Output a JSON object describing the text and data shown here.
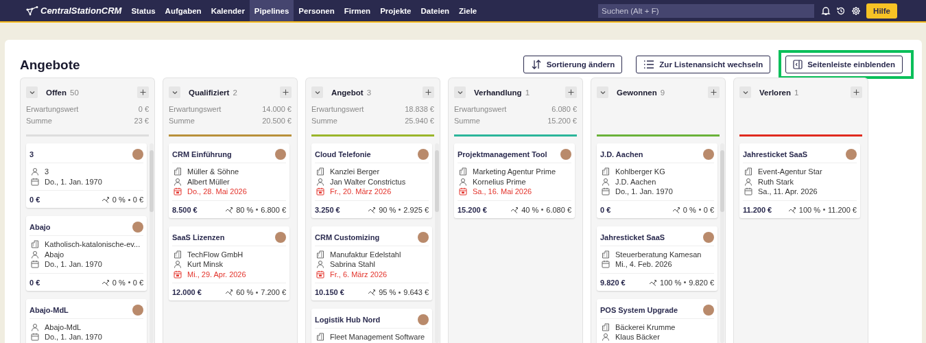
{
  "app": {
    "logo": "CentralStationCRM",
    "nav": [
      {
        "label": "Status",
        "selected": false
      },
      {
        "label": "Aufgaben",
        "selected": false
      },
      {
        "label": "Kalender",
        "selected": false
      },
      {
        "label": "Pipelines",
        "selected": true
      },
      {
        "label": "Personen",
        "selected": false
      },
      {
        "label": "Firmen",
        "selected": false
      },
      {
        "label": "Projekte",
        "selected": false
      },
      {
        "label": "Dateien",
        "selected": false
      },
      {
        "label": "Ziele",
        "selected": false
      }
    ],
    "search": {
      "placeholder": "Suchen (Alt + F)"
    },
    "help_button": "Hilfe"
  },
  "page": {
    "title": "Angebote",
    "actions": [
      {
        "kind": "sort",
        "label": "Sortierung ändern",
        "highlighted": false
      },
      {
        "kind": "list",
        "label": "Zur Listenansicht wechseln",
        "highlighted": false
      },
      {
        "kind": "sidebar",
        "label": "Seitenleiste einblenden",
        "highlighted": true
      }
    ]
  },
  "columns": [
    {
      "name": "Offen",
      "count": "50",
      "stats": [
        {
          "label": "Erwartungswert",
          "value": "0 €"
        },
        {
          "label": "Summe",
          "value": "23 €"
        }
      ],
      "color": "#dddddd",
      "cards": [
        {
          "title": "3",
          "lines": [
            {
              "kind": "person",
              "text": "3"
            },
            {
              "kind": "date",
              "text": "Do., 1. Jan. 1970",
              "overdue": false
            }
          ],
          "amount": "0 €",
          "probability": "0 %",
          "weighted": "0 €"
        },
        {
          "title": "Abajo",
          "lines": [
            {
              "kind": "company",
              "text": "Katholisch-katalonische-ev..."
            },
            {
              "kind": "person",
              "text": "Abajo"
            },
            {
              "kind": "date",
              "text": "Do., 1. Jan. 1970",
              "overdue": false
            }
          ],
          "amount": "0 €",
          "probability": "0 %",
          "weighted": "0 €"
        },
        {
          "title": "Abajo-MdL",
          "lines": [
            {
              "kind": "person",
              "text": "Abajo-MdL"
            },
            {
              "kind": "date",
              "text": "Do., 1. Jan. 1970",
              "overdue": false
            }
          ]
        }
      ]
    },
    {
      "name": "Qualifiziert",
      "count": "2",
      "stats": [
        {
          "label": "Erwartungswert",
          "value": "14.000 €"
        },
        {
          "label": "Summe",
          "value": "20.500 €"
        }
      ],
      "color": "#b8903a",
      "cards": [
        {
          "title": "CRM Einführung",
          "lines": [
            {
              "kind": "company",
              "text": "Müller & Söhne"
            },
            {
              "kind": "person",
              "text": "Albert Müller"
            },
            {
              "kind": "date",
              "text": "Do., 28. Mai 2026",
              "overdue": true
            }
          ],
          "amount": "8.500 €",
          "probability": "80 %",
          "weighted": "6.800 €"
        },
        {
          "title": "SaaS Lizenzen",
          "lines": [
            {
              "kind": "company",
              "text": "TechFlow GmbH"
            },
            {
              "kind": "person",
              "text": "Kurt Minsk"
            },
            {
              "kind": "date",
              "text": "Mi., 29. Apr. 2026",
              "overdue": true
            }
          ],
          "amount": "12.000 €",
          "probability": "60 %",
          "weighted": "7.200 €"
        }
      ]
    },
    {
      "name": "Angebot",
      "count": "3",
      "stats": [
        {
          "label": "Erwartungswert",
          "value": "18.838 €"
        },
        {
          "label": "Summe",
          "value": "25.940 €"
        }
      ],
      "color": "#9ab52a",
      "cards": [
        {
          "title": "Cloud Telefonie",
          "lines": [
            {
              "kind": "company",
              "text": "Kanzlei Berger"
            },
            {
              "kind": "person",
              "text": "Jan Walter Constrictus"
            },
            {
              "kind": "date",
              "text": "Fr., 20. März 2026",
              "overdue": true
            }
          ],
          "amount": "3.250 €",
          "probability": "90 %",
          "weighted": "2.925 €"
        },
        {
          "title": "CRM Customizing",
          "lines": [
            {
              "kind": "company",
              "text": "Manufaktur Edelstahl"
            },
            {
              "kind": "person",
              "text": "Sabrina Stahl"
            },
            {
              "kind": "date",
              "text": "Fr., 6. März 2026",
              "overdue": true
            }
          ],
          "amount": "10.150 €",
          "probability": "95 %",
          "weighted": "9.643 €"
        },
        {
          "title": "Logistik Hub Nord",
          "lines": [
            {
              "kind": "company",
              "text": "Fleet Management Software"
            }
          ]
        }
      ]
    },
    {
      "name": "Verhandlung",
      "count": "1",
      "stats": [
        {
          "label": "Erwartungswert",
          "value": "6.080 €"
        },
        {
          "label": "Summe",
          "value": "15.200 €"
        }
      ],
      "color": "#2bb59a",
      "cards": [
        {
          "title": "Projektmanagement Tool",
          "lines": [
            {
              "kind": "company",
              "text": "Marketing Agentur Prime"
            },
            {
              "kind": "person",
              "text": "Kornelius Prime"
            },
            {
              "kind": "date",
              "text": "Sa., 16. Mai 2026",
              "overdue": true
            }
          ],
          "amount": "15.200 €",
          "probability": "40 %",
          "weighted": "6.080 €"
        }
      ]
    },
    {
      "name": "Gewonnen",
      "count": "9",
      "color": "#6ab23a",
      "cards": [
        {
          "title": "J.D. Aachen",
          "lines": [
            {
              "kind": "company",
              "text": "Kohlberger KG"
            },
            {
              "kind": "person",
              "text": "J.D. Aachen"
            },
            {
              "kind": "date",
              "text": "Do., 1. Jan. 1970",
              "overdue": false
            }
          ],
          "amount": "0 €",
          "probability": "0 %",
          "weighted": "0 €"
        },
        {
          "title": "Jahresticket SaaS",
          "lines": [
            {
              "kind": "company",
              "text": "Steuerberatung Kamesan"
            },
            {
              "kind": "date",
              "text": "Mi., 4. Feb. 2026",
              "overdue": false
            }
          ],
          "amount": "9.820 €",
          "probability": "100 %",
          "weighted": "9.820 €"
        },
        {
          "title": "POS System Upgrade",
          "lines": [
            {
              "kind": "company",
              "text": "Bäckerei Krumme"
            },
            {
              "kind": "person",
              "text": "Klaus Bäcker"
            }
          ]
        }
      ]
    },
    {
      "name": "Verloren",
      "count": "1",
      "color": "#e02a1e",
      "cards": [
        {
          "title": "Jahresticket SaaS",
          "lines": [
            {
              "kind": "company",
              "text": "Event-Agentur Star"
            },
            {
              "kind": "person",
              "text": "Ruth Stark"
            },
            {
              "kind": "date",
              "text": "Sa., 11. Apr. 2026",
              "overdue": false
            }
          ],
          "amount": "11.200 €",
          "probability": "100 %",
          "weighted": "11.200 €"
        }
      ]
    }
  ]
}
